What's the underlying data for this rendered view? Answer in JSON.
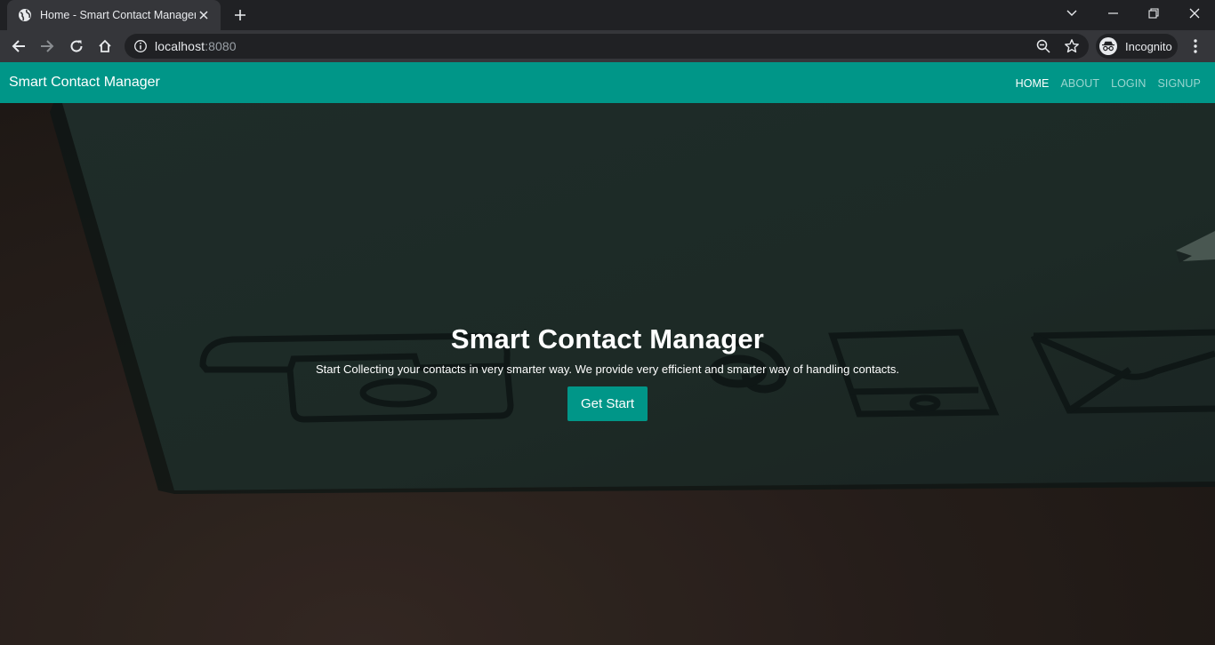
{
  "browser": {
    "tab": {
      "title": "Home - Smart Contact Manager",
      "icon": "globe-icon"
    },
    "address": {
      "host": "localhost",
      "port": ":8080"
    },
    "profile": {
      "label": "Incognito",
      "icon": "incognito-icon"
    }
  },
  "navbar": {
    "brand": "Smart Contact Manager",
    "links": [
      {
        "label": "HOME",
        "active": true
      },
      {
        "label": "ABOUT",
        "active": false
      },
      {
        "label": "LOGIN",
        "active": false
      },
      {
        "label": "SIGNUP",
        "active": false
      }
    ],
    "color": "#009688"
  },
  "hero": {
    "title": "Smart Contact Manager",
    "subtitle": "Start Collecting your contacts in very smarter way. We provide very efficient and smarter way of handling contacts.",
    "button_label": "Get Start"
  },
  "colors": {
    "accent": "#009688",
    "chrome_dark": "#202124",
    "chrome_toolbar": "#35363a"
  }
}
